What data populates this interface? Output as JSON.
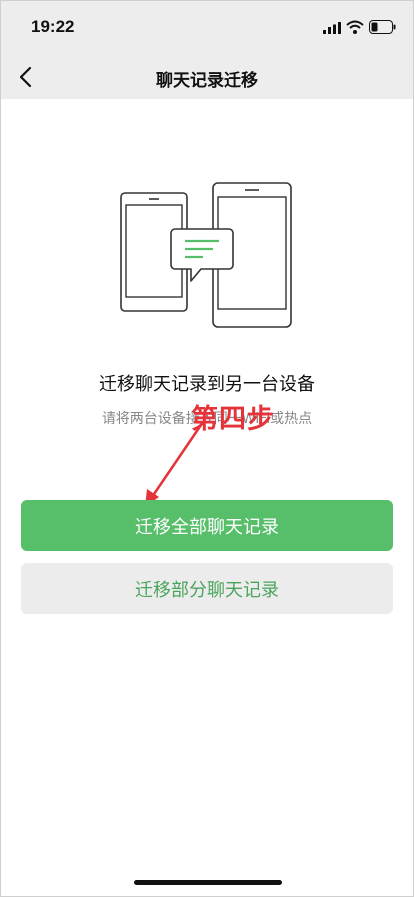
{
  "status_bar": {
    "time": "19:22"
  },
  "nav": {
    "title": "聊天记录迁移"
  },
  "main": {
    "headline": "迁移聊天记录到另一台设备",
    "subline": "请将两台设备接入同一WiFi或热点"
  },
  "annotation": {
    "text": "第四步",
    "color": "#e5333a"
  },
  "buttons": {
    "migrate_all": "迁移全部聊天记录",
    "migrate_partial": "迁移部分聊天记录"
  },
  "colors": {
    "accent": "#57be6a",
    "accent_text": "#4aa55c",
    "nav_background": "#ededed"
  },
  "icons": {
    "back": "chevron-left-icon",
    "signal": "cellular-signal-icon",
    "wifi": "wifi-icon",
    "battery": "battery-low-icon"
  }
}
